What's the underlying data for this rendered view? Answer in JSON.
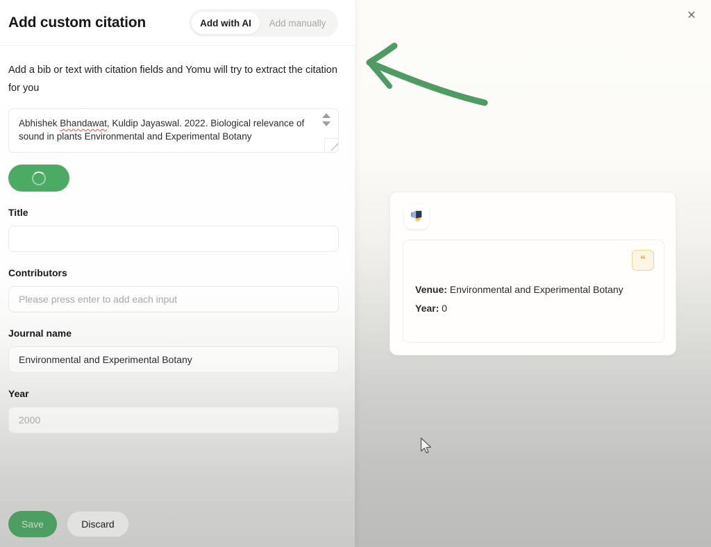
{
  "panel": {
    "title": "Add custom citation",
    "tabs": [
      {
        "label": "Add with AI",
        "active": true
      },
      {
        "label": "Add manually",
        "active": false
      }
    ],
    "intro": "Add a bib or text with citation fields and Yomu will try to extract the citation for you",
    "bib": {
      "text_before": "Abhishek ",
      "misspelled_word": "Bhandawat",
      "text_after": ", Kuldip Jayaswal. 2022. Biological relevance of sound in plants Environmental and Experimental Botany"
    },
    "extract_button": {
      "label": "",
      "state": "loading",
      "color": "#4bab65"
    },
    "fields": [
      {
        "label": "Title",
        "value": "",
        "placeholder": "",
        "is_placeholder": false
      },
      {
        "label": "Contributors",
        "value": "Please press enter to add each input",
        "is_placeholder": true
      },
      {
        "label": "Journal name",
        "value": "Environmental and Experimental Botany",
        "is_placeholder": false
      },
      {
        "label": "Year",
        "value": "2000",
        "is_placeholder": true
      }
    ],
    "footer": {
      "save_label": "Save",
      "discard_label": "Discard"
    }
  },
  "close_button": {
    "glyph": "✕"
  },
  "annotation": {
    "arrow_color": "#4e9b63"
  },
  "result_card": {
    "icon_name": "pages-stack-icon",
    "quote_badge_glyph": "“",
    "meta": [
      {
        "key": "Venue:",
        "value": " Environmental and Experimental Botany"
      },
      {
        "key": "Year:",
        "value": " 0"
      }
    ]
  }
}
